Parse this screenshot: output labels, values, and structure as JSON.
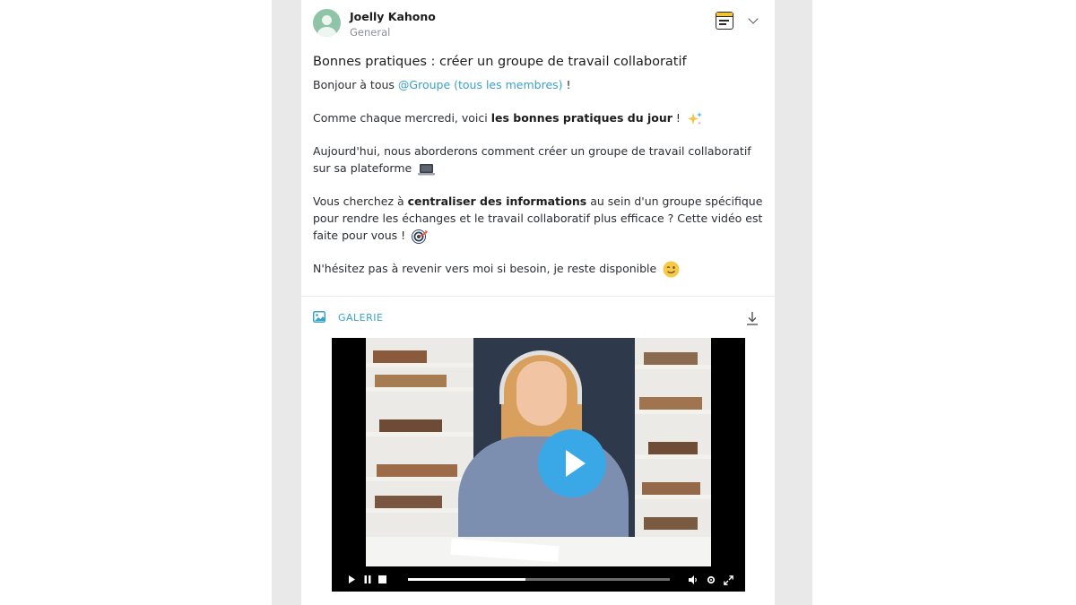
{
  "post": {
    "author": "Joelly Kahono",
    "channel": "General",
    "title": "Bonnes pratiques : créer un groupe de travail collaboratif",
    "p1_pre": "Bonjour à tous ",
    "p1_mention": "@Groupe (tous les membres)",
    "p1_post": " !",
    "p2_pre": "Comme chaque mercredi, voici ",
    "p2_bold": "les bonnes pratiques du jour",
    "p2_post": " !",
    "p3": "Aujourd'hui, nous aborderons comment créer un groupe de travail collaboratif sur sa plateforme",
    "p4_pre": "Vous cherchez à ",
    "p4_bold": "centraliser des informations",
    "p4_post": " au sein d'un groupe spécifique pour rendre les échanges et le travail collaboratif plus efficace ? Cette vidéo est faite pour vous !",
    "p5": "N'hésitez pas à revenir vers moi si besoin, je reste disponible"
  },
  "gallery": {
    "label": "GALERIE"
  },
  "video": {
    "progress": 0.45
  },
  "icons": {
    "avatar": "user-avatar-icon",
    "note": "notepad-icon",
    "menu": "chevron-down-icon",
    "gallery": "image-icon",
    "download": "download-icon",
    "play": "play-icon"
  },
  "colors": {
    "accent": "#3aa1c9",
    "play_button": "#3aa8e6"
  }
}
